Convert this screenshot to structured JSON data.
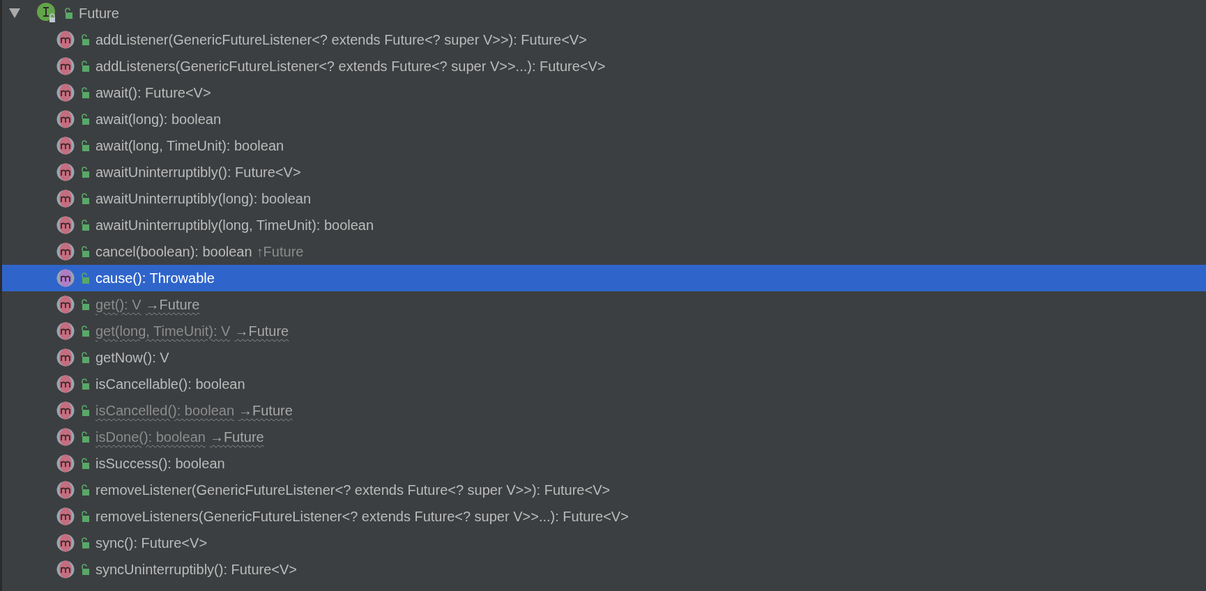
{
  "tree": {
    "label": "Future",
    "expanded": true,
    "children": [
      {
        "label": "addListener(GenericFutureListener<? extends Future<? super V>>): Future<V>",
        "selected": false,
        "dimmed": false
      },
      {
        "label": "addListeners(GenericFutureListener<? extends Future<? super V>>...): Future<V>",
        "selected": false,
        "dimmed": false
      },
      {
        "label": "await(): Future<V>",
        "selected": false,
        "dimmed": false
      },
      {
        "label": "await(long): boolean",
        "selected": false,
        "dimmed": false
      },
      {
        "label": "await(long, TimeUnit): boolean",
        "selected": false,
        "dimmed": false
      },
      {
        "label": "awaitUninterruptibly(): Future<V>",
        "selected": false,
        "dimmed": false
      },
      {
        "label": "awaitUninterruptibly(long): boolean",
        "selected": false,
        "dimmed": false
      },
      {
        "label": "awaitUninterruptibly(long, TimeUnit): boolean",
        "selected": false,
        "dimmed": false
      },
      {
        "label": "cancel(boolean): boolean",
        "suffix": "↑Future",
        "selected": false,
        "dimmed": false
      },
      {
        "label": "cause(): Throwable",
        "selected": true,
        "dimmed": false
      },
      {
        "label": "get(): V",
        "suffix": "→Future",
        "selected": false,
        "dimmed": true
      },
      {
        "label": "get(long, TimeUnit): V",
        "suffix": "→Future",
        "selected": false,
        "dimmed": true
      },
      {
        "label": "getNow(): V",
        "selected": false,
        "dimmed": false
      },
      {
        "label": "isCancellable(): boolean",
        "selected": false,
        "dimmed": false
      },
      {
        "label": "isCancelled(): boolean",
        "suffix": "→Future",
        "selected": false,
        "dimmed": true
      },
      {
        "label": "isDone(): boolean",
        "suffix": "→Future",
        "selected": false,
        "dimmed": true
      },
      {
        "label": "isSuccess(): boolean",
        "selected": false,
        "dimmed": false
      },
      {
        "label": "removeListener(GenericFutureListener<? extends Future<? super V>>): Future<V>",
        "selected": false,
        "dimmed": false
      },
      {
        "label": "removeListeners(GenericFutureListener<? extends Future<? super V>>...): Future<V>",
        "selected": false,
        "dimmed": false
      },
      {
        "label": "sync(): Future<V>",
        "selected": false,
        "dimmed": false
      },
      {
        "label": "syncUninterruptibly(): Future<V>",
        "selected": false,
        "dimmed": false
      }
    ]
  }
}
